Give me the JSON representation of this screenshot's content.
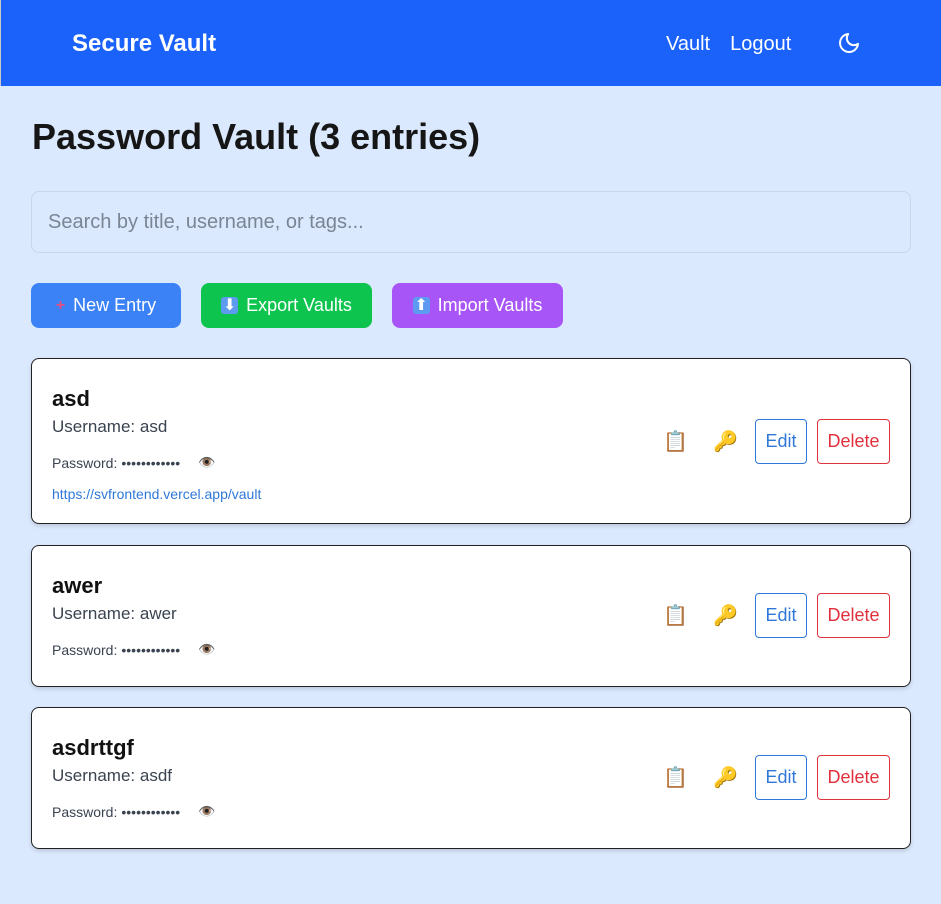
{
  "app": {
    "title": "Secure Vault"
  },
  "nav": {
    "links": [
      "Vault",
      "Logout"
    ],
    "theme_icon": "moon-icon"
  },
  "page": {
    "title": "Password Vault (3 entries)"
  },
  "search": {
    "placeholder": "Search by title, username, or tags...",
    "value": ""
  },
  "actions": {
    "new_label": "New Entry",
    "export_label": "Export Vaults",
    "import_label": "Import Vaults"
  },
  "entries": [
    {
      "title": "asd",
      "username": "Username: asd",
      "password_label": "Password:",
      "password_mask": "••••••••••••",
      "url": "https://svfrontend.vercel.app/vault",
      "edit_label": "Edit",
      "delete_label": "Delete"
    },
    {
      "title": "awer",
      "username": "Username: awer",
      "password_label": "Password:",
      "password_mask": "••••••••••••",
      "edit_label": "Edit",
      "delete_label": "Delete"
    },
    {
      "title": "asdrttgf",
      "username": "Username: asdf",
      "password_label": "Password:",
      "password_mask": "••••••••••••",
      "edit_label": "Edit",
      "delete_label": "Delete"
    }
  ],
  "colors": {
    "navbar": "#1b62fb",
    "background": "#dbe9fe",
    "new_button": "#3b82f6",
    "export_button": "#0dc54e",
    "import_button": "#a855f7",
    "edit": "#2f78d9",
    "delete": "#e0303c"
  }
}
